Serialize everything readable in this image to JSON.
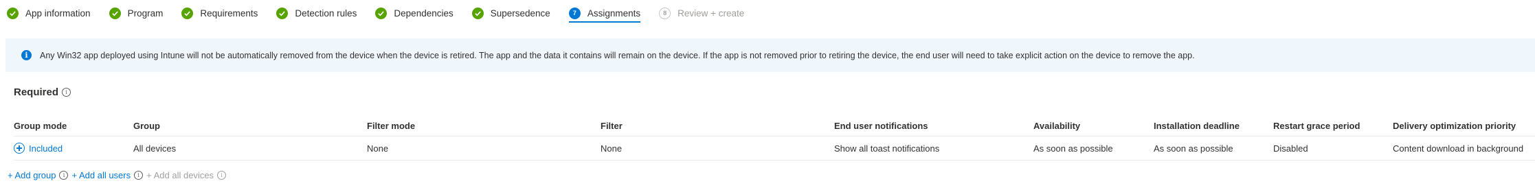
{
  "steps": [
    {
      "label": "App information",
      "status": "done"
    },
    {
      "label": "Program",
      "status": "done"
    },
    {
      "label": "Requirements",
      "status": "done"
    },
    {
      "label": "Detection rules",
      "status": "done"
    },
    {
      "label": "Dependencies",
      "status": "done"
    },
    {
      "label": "Supersedence",
      "status": "done"
    },
    {
      "label": "Assignments",
      "status": "active",
      "number": "7"
    },
    {
      "label": "Review + create",
      "status": "disabled",
      "number": "8"
    }
  ],
  "banner": {
    "icon": "info-icon",
    "text": "Any Win32 app deployed using Intune will not be automatically removed from the device when the device is retired. The app and the data it contains will remain on the device. If the app is not removed prior to retiring the device, the end user will need to take explicit action on the device to remove the app."
  },
  "section": {
    "title": "Required"
  },
  "table": {
    "headers": [
      "Group mode",
      "Group",
      "Filter mode",
      "Filter",
      "End user notifications",
      "Availability",
      "Installation deadline",
      "Restart grace period",
      "Delivery optimization priority"
    ],
    "rows": [
      {
        "group_mode": "Included",
        "group": "All devices",
        "filter_mode": "None",
        "filter": "None",
        "end_user_notifications": "Show all toast notifications",
        "availability": "As soon as possible",
        "installation_deadline": "As soon as possible",
        "restart_grace_period": "Disabled",
        "delivery_optimization_priority": "Content download in background"
      }
    ]
  },
  "actions": {
    "add_group": "+ Add group",
    "add_all_users": "+ Add all users",
    "add_all_devices": "+ Add all devices"
  },
  "colors": {
    "accent": "#0078d4",
    "success": "#57a300",
    "banner_bg": "#eff6fc"
  }
}
